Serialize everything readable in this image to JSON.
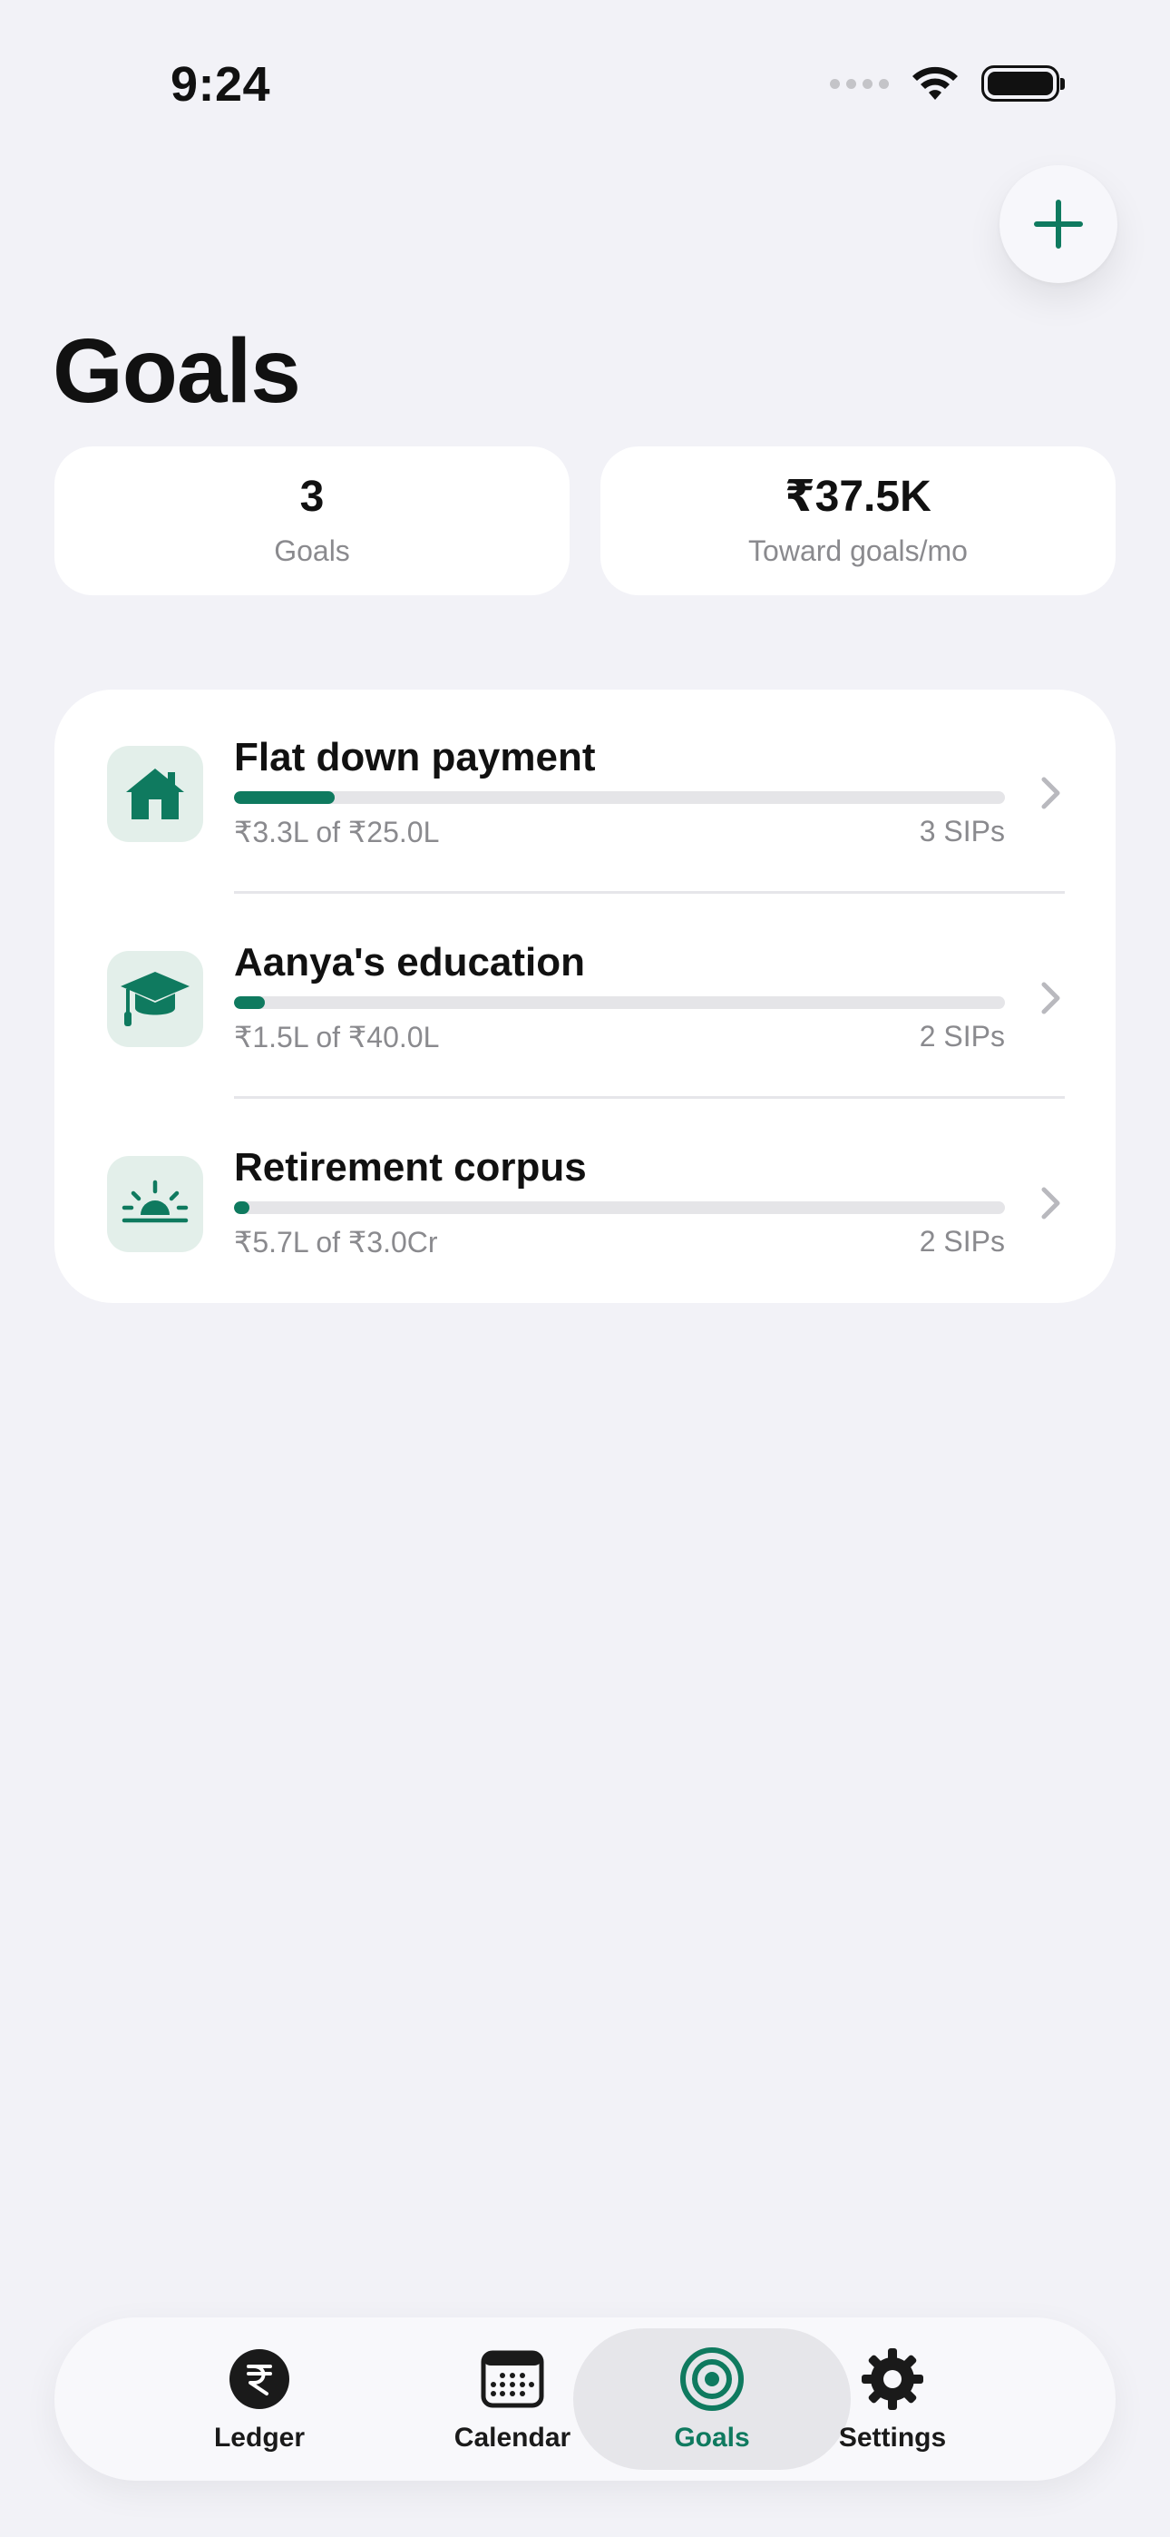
{
  "status_bar": {
    "time": "9:24"
  },
  "header": {
    "title": "Goals"
  },
  "stats": [
    {
      "value": "3",
      "label": "Goals"
    },
    {
      "value": "₹37.5K",
      "label": "Toward goals/mo"
    }
  ],
  "goals": [
    {
      "name": "Flat down payment",
      "amount": "₹3.3L of ₹25.0L",
      "sips": "3 SIPs",
      "progress": 0.13,
      "icon": "house-icon"
    },
    {
      "name": "Aanya's education",
      "amount": "₹1.5L of ₹40.0L",
      "sips": "2 SIPs",
      "progress": 0.04,
      "icon": "graduation-cap-icon"
    },
    {
      "name": "Retirement corpus",
      "amount": "₹5.7L of ₹3.0Cr",
      "sips": "2 SIPs",
      "progress": 0.02,
      "icon": "sunrise-icon"
    }
  ],
  "tabs": [
    {
      "label": "Ledger",
      "icon": "rupee-icon"
    },
    {
      "label": "Calendar",
      "icon": "calendar-icon"
    },
    {
      "label": "Goals",
      "icon": "target-icon",
      "active": true
    },
    {
      "label": "Settings",
      "icon": "gear-icon"
    }
  ],
  "colors": {
    "accent": "#0f7a5f",
    "icon_bg": "#e3efea",
    "background": "#f2f2f7"
  }
}
